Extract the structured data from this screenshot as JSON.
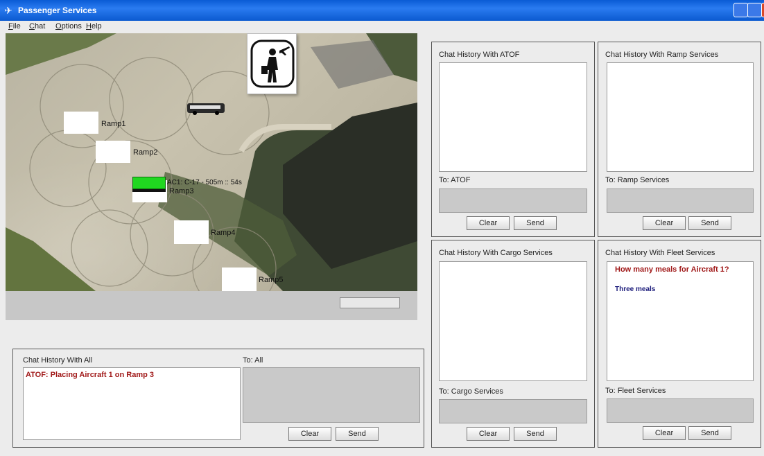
{
  "window": {
    "title": "Passenger Services"
  },
  "menu": {
    "items": [
      "File",
      "Chat",
      "Options",
      "Help"
    ]
  },
  "map": {
    "ramps": [
      "Ramp1",
      "Ramp2",
      "Ramp3",
      "Ramp4",
      "Ramp5"
    ],
    "aircraft_label": "AC1: C-17 - 505m :: 54s",
    "icons": [
      "passenger-icon",
      "bus-icon",
      "aircraft-icon"
    ]
  },
  "panels": {
    "all": {
      "history_title": "Chat History With All",
      "to_label": "To: All",
      "messages": [
        {
          "text": "ATOF:  Placing Aircraft 1 on Ramp 3",
          "color": "#a01818"
        }
      ],
      "clear_label": "Clear",
      "send_label": "Send"
    },
    "atof": {
      "history_title": "Chat History With ATOF",
      "to_label": "To: ATOF",
      "clear_label": "Clear",
      "send_label": "Send"
    },
    "ramp": {
      "history_title": "Chat History With Ramp Services",
      "to_label": "To: Ramp Services",
      "clear_label": "Clear",
      "send_label": "Send"
    },
    "cargo": {
      "history_title": "Chat History With Cargo Services",
      "to_label": "To: Cargo Services",
      "clear_label": "Clear",
      "send_label": "Send"
    },
    "fleet": {
      "history_title": "Chat History With Fleet Services",
      "to_label": "To: Fleet Services",
      "messages": [
        {
          "text": "How many meals for Aircraft 1?",
          "color": "#a01818"
        },
        {
          "text": "Three meals",
          "color": "#1a1a7a"
        }
      ],
      "clear_label": "Clear",
      "send_label": "Send"
    }
  }
}
